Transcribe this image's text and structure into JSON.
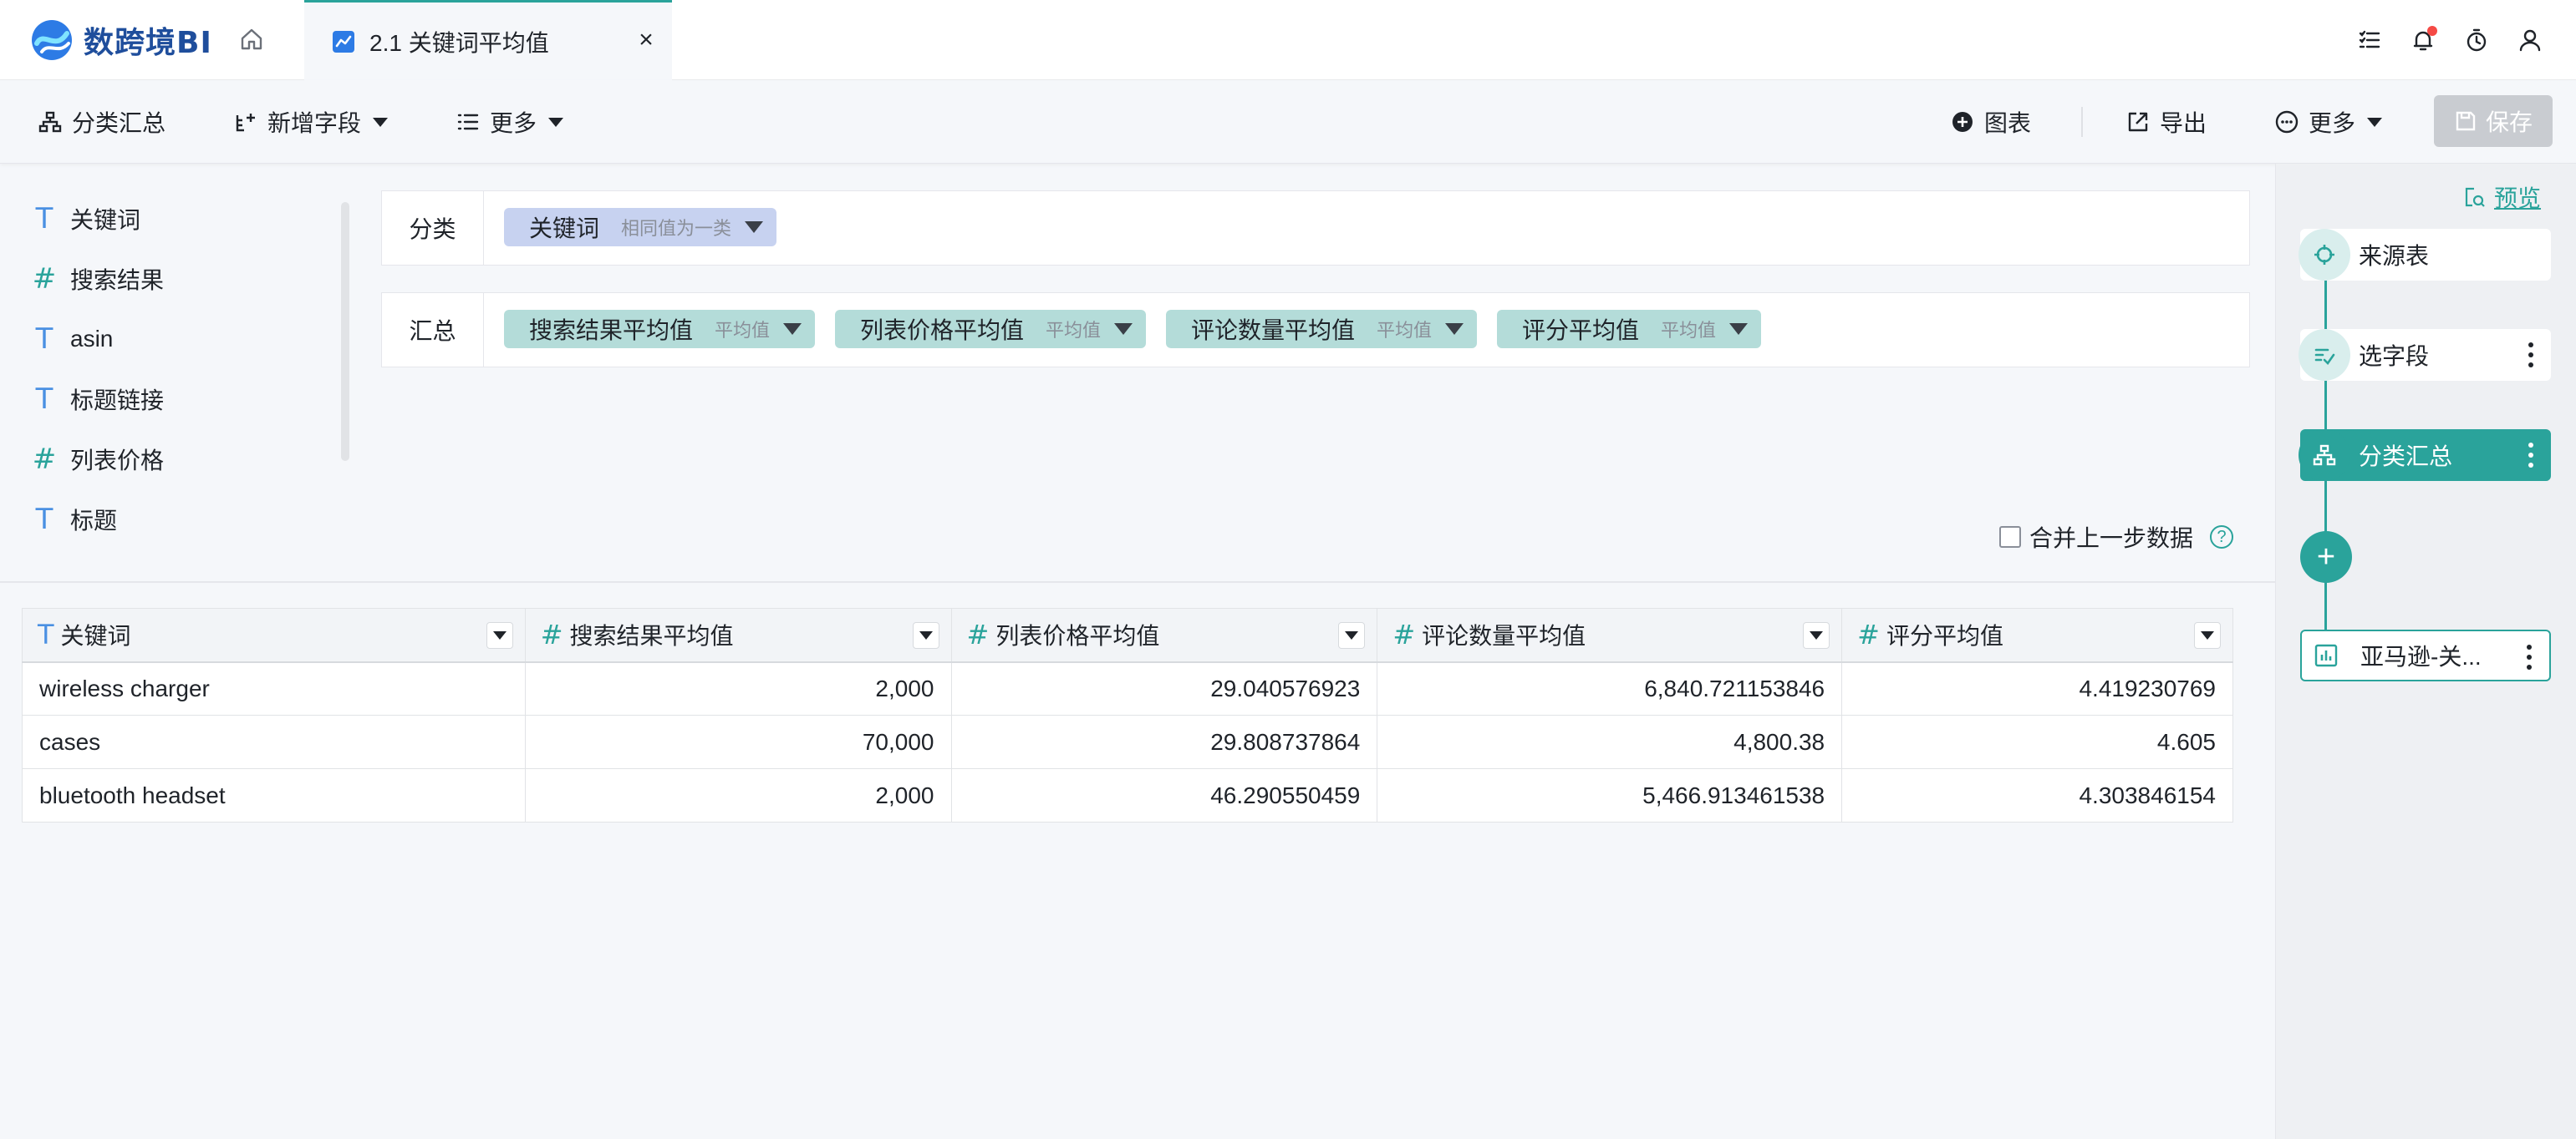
{
  "app": {
    "logo_text": "数跨境BI",
    "tab_label": "2.1 关键词平均值",
    "tab_close": "×"
  },
  "toolbar": {
    "group_summary": "分类汇总",
    "add_field": "新增字段",
    "more_left": "更多",
    "chart": "图表",
    "export": "导出",
    "more_right": "更多",
    "save": "保存"
  },
  "fields": [
    {
      "type": "text",
      "glyph": "T",
      "name": "关键词"
    },
    {
      "type": "number",
      "glyph": "#",
      "name": "搜索结果"
    },
    {
      "type": "text",
      "glyph": "T",
      "name": "asin"
    },
    {
      "type": "text",
      "glyph": "T",
      "name": "标题链接"
    },
    {
      "type": "number",
      "glyph": "#",
      "name": "列表价格"
    },
    {
      "type": "text",
      "glyph": "T",
      "name": "标题"
    }
  ],
  "group": {
    "label": "分类",
    "chip": {
      "name": "关键词",
      "sub": "相同值为一类"
    }
  },
  "summary": {
    "label": "汇总",
    "chips": [
      {
        "name": "搜索结果平均值",
        "sub": "平均值"
      },
      {
        "name": "列表价格平均值",
        "sub": "平均值"
      },
      {
        "name": "评论数量平均值",
        "sub": "平均值"
      },
      {
        "name": "评分平均值",
        "sub": "平均值"
      }
    ]
  },
  "merge_label": "合并上一步数据",
  "help_glyph": "?",
  "table": {
    "columns": [
      {
        "type": "text",
        "glyph": "T",
        "name": "关键词"
      },
      {
        "type": "number",
        "glyph": "#",
        "name": "搜索结果平均值"
      },
      {
        "type": "number",
        "glyph": "#",
        "name": "列表价格平均值"
      },
      {
        "type": "number",
        "glyph": "#",
        "name": "评论数量平均值"
      },
      {
        "type": "number",
        "glyph": "#",
        "name": "评分平均值"
      }
    ],
    "rows": [
      [
        "wireless charger",
        "2,000",
        "29.040576923",
        "6,840.721153846",
        "4.419230769"
      ],
      [
        "cases",
        "70,000",
        "29.808737864",
        "4,800.38",
        "4.605"
      ],
      [
        "bluetooth headset",
        "2,000",
        "46.290550459",
        "5,466.913461538",
        "4.303846154"
      ]
    ]
  },
  "flow": {
    "preview": "预览",
    "nodes": {
      "source": "来源表",
      "select": "选字段",
      "group": "分类汇总",
      "add": "+",
      "output": "亚马逊-关..."
    }
  },
  "colors": {
    "accent": "#2aa39b",
    "chip_blue": "#c7d2f0",
    "chip_teal": "#b4dcd9",
    "text_type": "#4a90e2"
  }
}
